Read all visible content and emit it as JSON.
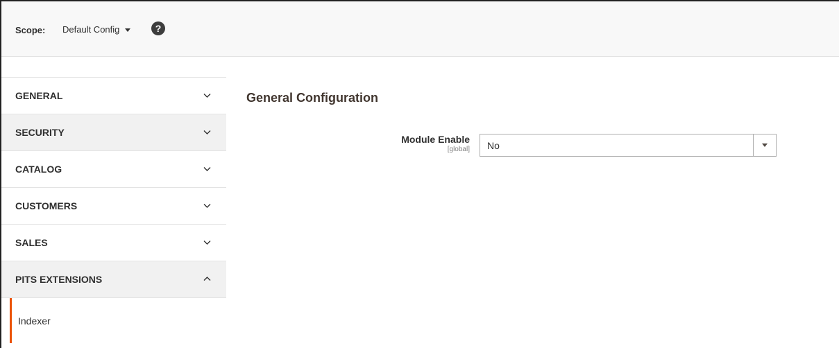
{
  "scope": {
    "label": "Scope:",
    "value": "Default Config",
    "help_icon": "question-icon"
  },
  "sidebar": {
    "tabs": [
      {
        "label": "GENERAL",
        "icon": "chevron-down-icon"
      },
      {
        "label": "SECURITY",
        "icon": "chevron-down-icon"
      },
      {
        "label": "CATALOG",
        "icon": "chevron-down-icon"
      },
      {
        "label": "CUSTOMERS",
        "icon": "chevron-down-icon"
      },
      {
        "label": "SALES",
        "icon": "chevron-down-icon"
      },
      {
        "label": "PITS EXTENSIONS",
        "icon": "chevron-up-icon"
      }
    ],
    "active_item": {
      "label": "Indexer"
    }
  },
  "main": {
    "section_title": "General Configuration",
    "field": {
      "label": "Module Enable",
      "scope": "[global]",
      "value": "No"
    }
  },
  "colors": {
    "accent": "#eb5202",
    "scope_bar_bg": "#f8f8f8",
    "tab_alt_bg": "#f1f1f1"
  }
}
